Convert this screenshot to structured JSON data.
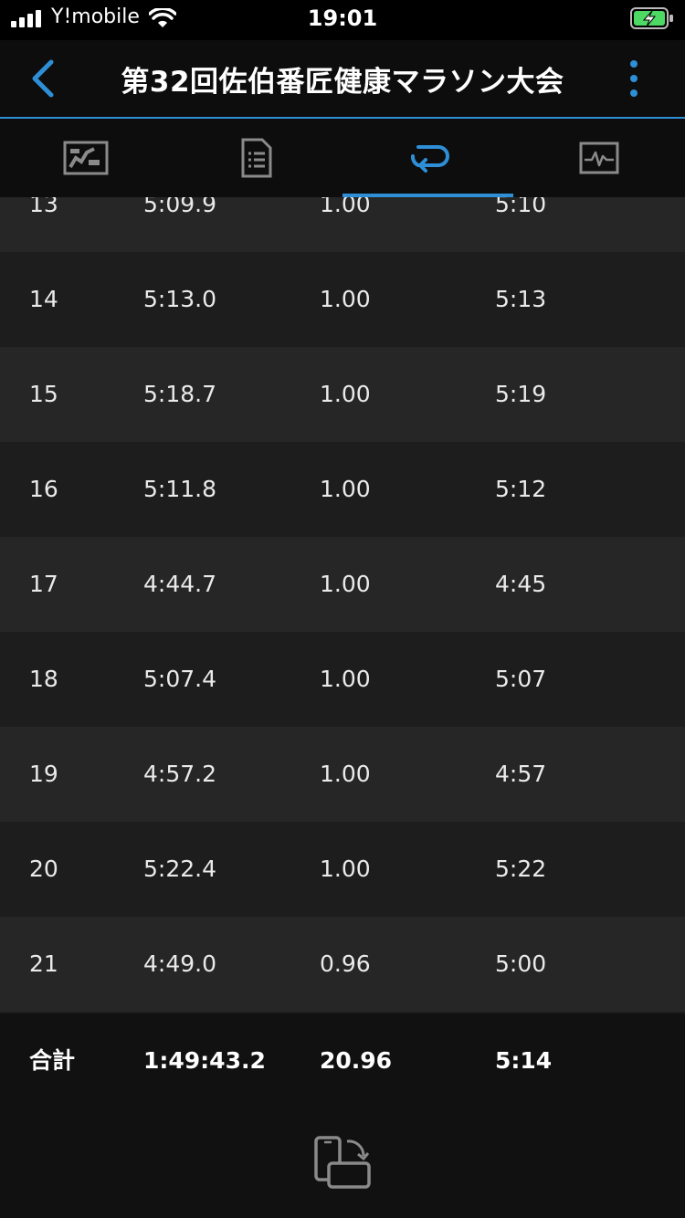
{
  "status_bar": {
    "carrier": "Y!mobile",
    "time": "19:01"
  },
  "header": {
    "title": "第32回佐伯番匠健康マラソン大会"
  },
  "tabs": [
    {
      "icon": "map-icon"
    },
    {
      "icon": "details-icon"
    },
    {
      "icon": "laps-icon",
      "active": true
    },
    {
      "icon": "chart-icon"
    }
  ],
  "laps": [
    {
      "lap": "13",
      "time": "5:09.9",
      "distance": "1.00",
      "pace": "5:10"
    },
    {
      "lap": "14",
      "time": "5:13.0",
      "distance": "1.00",
      "pace": "5:13"
    },
    {
      "lap": "15",
      "time": "5:18.7",
      "distance": "1.00",
      "pace": "5:19"
    },
    {
      "lap": "16",
      "time": "5:11.8",
      "distance": "1.00",
      "pace": "5:12"
    },
    {
      "lap": "17",
      "time": "4:44.7",
      "distance": "1.00",
      "pace": "4:45"
    },
    {
      "lap": "18",
      "time": "5:07.4",
      "distance": "1.00",
      "pace": "5:07"
    },
    {
      "lap": "19",
      "time": "4:57.2",
      "distance": "1.00",
      "pace": "4:57"
    },
    {
      "lap": "20",
      "time": "5:22.4",
      "distance": "1.00",
      "pace": "5:22"
    },
    {
      "lap": "21",
      "time": "4:49.0",
      "distance": "0.96",
      "pace": "5:00"
    }
  ],
  "total": {
    "label": "合計",
    "time": "1:49:43.2",
    "distance": "20.96",
    "pace": "5:14"
  },
  "colors": {
    "accent": "#2e8fd6",
    "battery": "#4cd964"
  }
}
